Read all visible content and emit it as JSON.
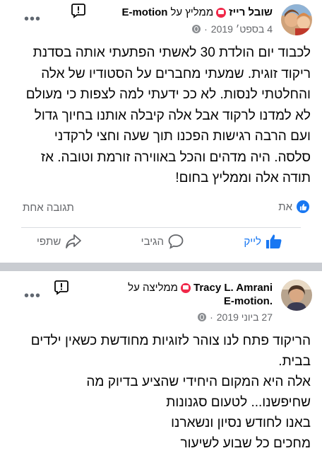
{
  "post1": {
    "author": "שובל רייז",
    "recommends_prefix": "ממליץ על",
    "page_name": "E-motion",
    "date": "4 בספט׳ 2019",
    "body_lines": [
      "לכבוד יום הולדת 30 לאשתי הפתעתי אותה בסדנת",
      "ריקוד זוגית. שמעתי מחברים על הסטודיו של אלה",
      "והחלטתי לנסות. לא ככ ידעתי למה לצפות כי מעולם",
      "לא למדנו לרקוד אבל אלה קיבלה אותנו בחיוך גדול",
      "ועם הרבה רגישות הפכנו תוך שעה וחצי לרקדני",
      "סלסה. היה מדהים והכל באווירה זורמת וטובה. אז",
      "תודה אלה וממליץ בחום!"
    ],
    "like_count_label": "את",
    "comment_count_label": "תגובה אחת",
    "actions": {
      "like": "לייק",
      "comment": "הגיבי",
      "share": "שתפי"
    }
  },
  "post2": {
    "author": "Tracy L. Amrani",
    "recommends_prefix": "ממליצה על",
    "page_name": "E-motion.",
    "date": "27 ביוני 2019",
    "body_lines": [
      "הריקוד פתח לנו צוהר לזוגיות מחודשת כשאין ילדים",
      "בבית.",
      "אלה היא המקום היחידי שהציע בדיוק מה",
      "שחיפשנו... לטעום סגנונות",
      "באנו לחודש נסיון ונשארנו",
      "מחכים כל שבוע לשיעור"
    ]
  },
  "colors": {
    "facebook_blue": "#1877f2",
    "recommend_red": "#f02849",
    "secondary_text": "#65676b",
    "separator": "#c9ccd1"
  }
}
